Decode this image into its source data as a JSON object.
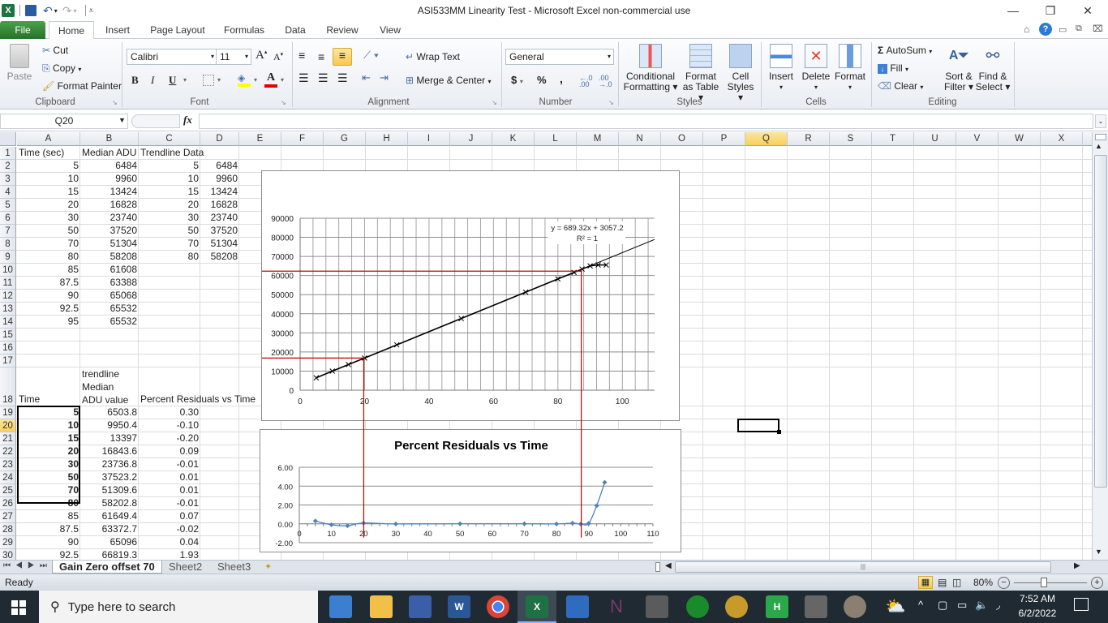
{
  "window": {
    "title": "ASI533MM Linearity Test  -  Microsoft Excel non-commercial use",
    "minimize": "—",
    "restore": "❐",
    "close": "✕"
  },
  "tabs": [
    {
      "label": "File"
    },
    {
      "label": "Home"
    },
    {
      "label": "Insert"
    },
    {
      "label": "Page Layout"
    },
    {
      "label": "Formulas"
    },
    {
      "label": "Data"
    },
    {
      "label": "Review"
    },
    {
      "label": "View"
    }
  ],
  "ribbon": {
    "clipboard": {
      "paste": "Paste",
      "cut": "Cut",
      "copy": "Copy",
      "format_painter": "Format Painter",
      "label": "Clipboard"
    },
    "font": {
      "name": "Calibri",
      "size": "11",
      "bold": "B",
      "italic": "I",
      "underline": "U",
      "label": "Font",
      "grow": "A",
      "shrink": "A"
    },
    "alignment": {
      "wrap_text": "Wrap Text",
      "merge_center": "Merge & Center",
      "label": "Alignment"
    },
    "number": {
      "format": "General",
      "currency": "$",
      "percent": "%",
      "comma": ",",
      "inc_dec": "←.0 .00",
      "dec_dec": ".00 →.0",
      "label": "Number"
    },
    "styles": {
      "conditional": [
        "Conditional",
        "Formatting ▾"
      ],
      "format_table": [
        "Format",
        "as Table ▾"
      ],
      "cell_styles": [
        "Cell",
        "Styles ▾"
      ],
      "label": "Styles"
    },
    "cells": {
      "insert": "Insert",
      "delete": "Delete",
      "format": "Format",
      "label": "Cells"
    },
    "editing": {
      "autosum": "AutoSum",
      "fill": "Fill",
      "clear": "Clear",
      "sort_filter": [
        "Sort &",
        "Filter ▾"
      ],
      "find_select": [
        "Find &",
        "Select ▾"
      ],
      "label": "Editing"
    }
  },
  "formula_bar": {
    "name_box": "Q20",
    "fx": "fx",
    "formula": ""
  },
  "columns": [
    "A",
    "B",
    "C",
    "D",
    "E",
    "F",
    "G",
    "H",
    "I",
    "J",
    "K",
    "L",
    "M",
    "N",
    "O",
    "P",
    "Q",
    "R",
    "S",
    "T",
    "U",
    "V",
    "W",
    "X",
    "Y"
  ],
  "selected_column": "Q",
  "selected_row": "20",
  "rows": [
    "1",
    "2",
    "3",
    "4",
    "5",
    "6",
    "7",
    "8",
    "9",
    "10",
    "11",
    "12",
    "13",
    "14",
    "15",
    "16",
    "17",
    "18",
    "19",
    "20",
    "21",
    "22",
    "23",
    "24",
    "25",
    "26",
    "27",
    "28",
    "29",
    "30"
  ],
  "sheet": {
    "header1": {
      "a": "Time (sec)",
      "b": "Median ADU",
      "c": "Trendline Data"
    },
    "table1": [
      {
        "a": "5",
        "b": "6484",
        "c": "5",
        "d": "6484"
      },
      {
        "a": "10",
        "b": "9960",
        "c": "10",
        "d": "9960"
      },
      {
        "a": "15",
        "b": "13424",
        "c": "15",
        "d": "13424"
      },
      {
        "a": "20",
        "b": "16828",
        "c": "20",
        "d": "16828"
      },
      {
        "a": "30",
        "b": "23740",
        "c": "30",
        "d": "23740"
      },
      {
        "a": "50",
        "b": "37520",
        "c": "50",
        "d": "37520"
      },
      {
        "a": "70",
        "b": "51304",
        "c": "70",
        "d": "51304"
      },
      {
        "a": "80",
        "b": "58208",
        "c": "80",
        "d": "58208"
      },
      {
        "a": "85",
        "b": "61608",
        "c": "",
        "d": ""
      },
      {
        "a": "87.5",
        "b": "63388",
        "c": "",
        "d": ""
      },
      {
        "a": "90",
        "b": "65068",
        "c": "",
        "d": ""
      },
      {
        "a": "92.5",
        "b": "65532",
        "c": "",
        "d": ""
      },
      {
        "a": "95",
        "b": "65532",
        "c": "",
        "d": ""
      }
    ],
    "header2": {
      "a": "Time",
      "b1": "trendline",
      "b2": "Median",
      "b3": "ADU value",
      "c": "Percent Residuals vs Time"
    },
    "table2": [
      {
        "a": "5",
        "b": "6503.8",
        "c": "0.30"
      },
      {
        "a": "10",
        "b": "9950.4",
        "c": "-0.10"
      },
      {
        "a": "15",
        "b": "13397",
        "c": "-0.20"
      },
      {
        "a": "20",
        "b": "16843.6",
        "c": "0.09"
      },
      {
        "a": "30",
        "b": "23736.8",
        "c": "-0.01"
      },
      {
        "a": "50",
        "b": "37523.2",
        "c": "0.01"
      },
      {
        "a": "70",
        "b": "51309.6",
        "c": "0.01"
      },
      {
        "a": "80",
        "b": "58202.8",
        "c": "-0.01"
      },
      {
        "a": "85",
        "b": "61649.4",
        "c": "0.07"
      },
      {
        "a": "87.5",
        "b": "63372.7",
        "c": "-0.02"
      },
      {
        "a": "90",
        "b": "65096",
        "c": "0.04"
      },
      {
        "a": "92.5",
        "b": "66819.3",
        "c": "1.93"
      }
    ]
  },
  "chart_data": [
    {
      "type": "scatter",
      "title": "",
      "xlabel": "",
      "ylabel": "",
      "xlim": [
        0,
        110
      ],
      "ylim": [
        0,
        90000
      ],
      "x_ticks": [
        "0",
        "20",
        "40",
        "60",
        "80",
        "100"
      ],
      "y_ticks": [
        "0",
        "10000",
        "20000",
        "30000",
        "40000",
        "50000",
        "60000",
        "70000",
        "80000",
        "90000"
      ],
      "grid": true,
      "series": [
        {
          "name": "Median ADU",
          "x": [
            5,
            10,
            15,
            20,
            30,
            50,
            70,
            80,
            85,
            87.5,
            90,
            92.5,
            95
          ],
          "y": [
            6484,
            9960,
            13424,
            16828,
            23740,
            37520,
            51304,
            58208,
            61608,
            63388,
            65068,
            65532,
            65532
          ]
        }
      ],
      "trendline": {
        "slope": 689.32,
        "intercept": 3057.2,
        "x_range": [
          5,
          110
        ],
        "label_eq": "y = 689.32x + 3057.2",
        "label_r2": "R² = 1"
      },
      "annotations": [
        {
          "type": "vline",
          "x": 20,
          "color": "#c00000"
        },
        {
          "type": "hline",
          "y": 16828,
          "color": "#c00000"
        },
        {
          "type": "vline",
          "x": 87.5,
          "color": "#c00000"
        },
        {
          "type": "hline",
          "y": 62300,
          "color": "#c00000"
        }
      ]
    },
    {
      "type": "line",
      "title": "Percent Residuals vs Time",
      "xlabel": "",
      "ylabel": "",
      "xlim": [
        0,
        110
      ],
      "ylim": [
        -2,
        6
      ],
      "x_ticks": [
        "0",
        "10",
        "20",
        "30",
        "40",
        "50",
        "60",
        "70",
        "80",
        "90",
        "100",
        "110"
      ],
      "y_ticks": [
        "-2.00",
        "0.00",
        "2.00",
        "4.00",
        "6.00"
      ],
      "grid": true,
      "series": [
        {
          "name": "Percent Residuals",
          "color": "#4f81bd",
          "x": [
            5,
            10,
            15,
            20,
            30,
            50,
            70,
            80,
            85,
            87.5,
            90,
            92.5,
            95
          ],
          "y": [
            0.3,
            -0.1,
            -0.2,
            0.09,
            -0.01,
            0.01,
            0.01,
            -0.01,
            0.07,
            -0.02,
            0.04,
            1.93,
            4.4
          ]
        }
      ]
    }
  ],
  "sheet_tabs": [
    {
      "label": "Gain Zero offset 70",
      "active": true
    },
    {
      "label": "Sheet2"
    },
    {
      "label": "Sheet3"
    }
  ],
  "status": {
    "ready": "Ready",
    "zoom": "80%"
  },
  "taskbar": {
    "search_placeholder": "Type here to search",
    "time": "7:52 AM",
    "date": "6/2/2022"
  }
}
